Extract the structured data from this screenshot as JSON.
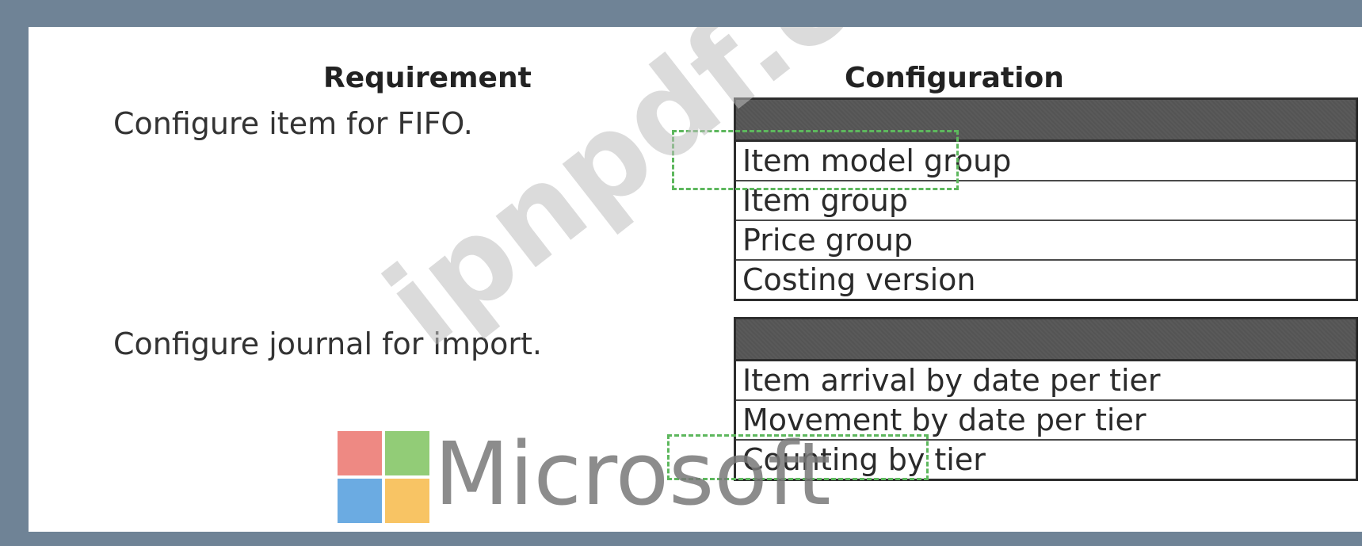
{
  "headers": {
    "requirement": "Requirement",
    "configuration": "Configuration"
  },
  "requirements": [
    "Configure item for FIFO.",
    "Configure journal for import."
  ],
  "dropdowns": [
    {
      "options": [
        "Item model group",
        "Item group",
        "Price group",
        "Costing version"
      ],
      "selected": "Item model group"
    },
    {
      "options": [
        "Item arrival by date per tier",
        "Movement by date per tier",
        "Counting by tier"
      ],
      "selected": "Counting by tier"
    }
  ],
  "watermark": "ipnpdf.com",
  "logo": {
    "text": "Microsoft",
    "colors": [
      "#e8625a",
      "#6dbb4a",
      "#3a8fd8",
      "#f5b030"
    ]
  }
}
